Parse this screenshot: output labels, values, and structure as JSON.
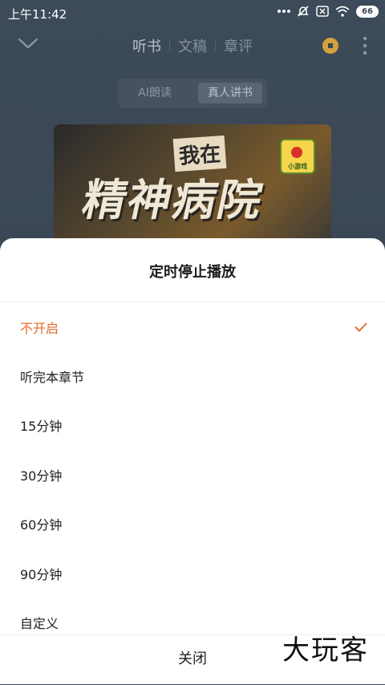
{
  "status_bar": {
    "time": "上午11:42",
    "battery": "66"
  },
  "nav": {
    "tabs": [
      "听书",
      "文稿",
      "章评"
    ],
    "active_tab": 0
  },
  "mode_switch": {
    "ai": "AI朗读",
    "real": "真人讲书"
  },
  "cover": {
    "subtitle": "我在",
    "title": "精神病院",
    "badge": "小游戏"
  },
  "sheet": {
    "title": "定时停止播放",
    "options": [
      "不开启",
      "听完本章节",
      "15分钟",
      "30分钟",
      "60分钟",
      "90分钟",
      "自定义"
    ],
    "selected_index": 0,
    "close_label": "关闭"
  },
  "watermark": "大玩客",
  "colors": {
    "accent": "#e66a2c",
    "background": "#3a4655",
    "sheet": "#ffffff"
  }
}
